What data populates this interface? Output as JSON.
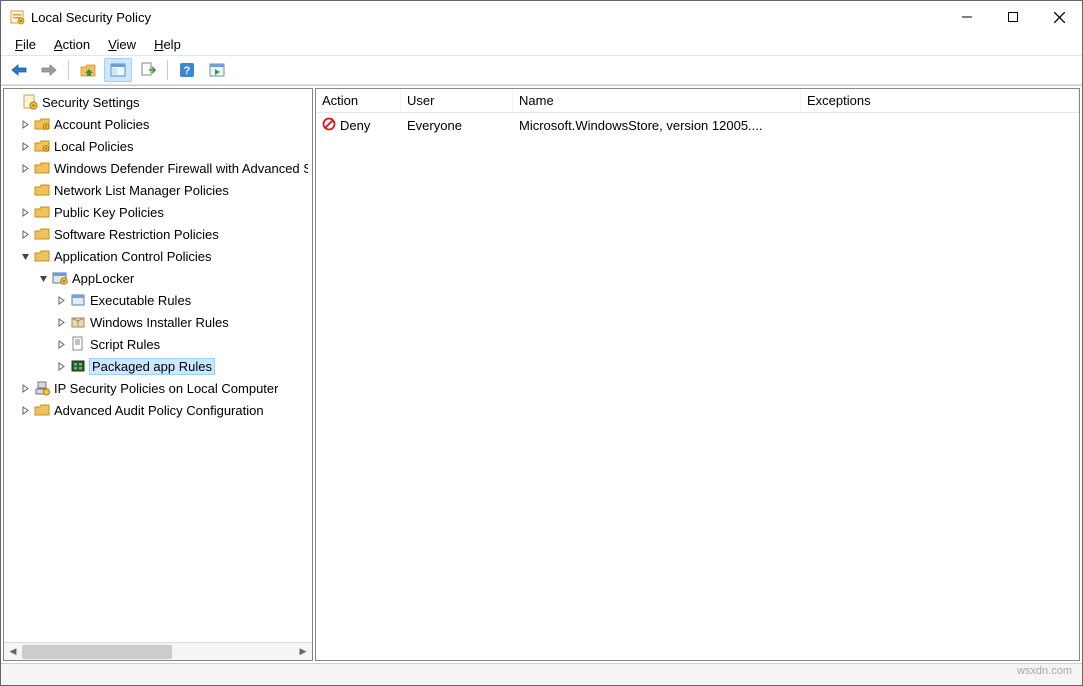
{
  "window": {
    "title": "Local Security Policy"
  },
  "menubar": {
    "file": "File",
    "action": "Action",
    "view": "View",
    "help": "Help"
  },
  "tree": {
    "root": "Security Settings",
    "account_policies": "Account Policies",
    "local_policies": "Local Policies",
    "wdf": "Windows Defender Firewall with Advanced Security",
    "nlm": "Network List Manager Policies",
    "pkp": "Public Key Policies",
    "srp": "Software Restriction Policies",
    "acp": "Application Control Policies",
    "applocker": "AppLocker",
    "exe_rules": "Executable Rules",
    "wi_rules": "Windows Installer Rules",
    "script_rules": "Script Rules",
    "pkg_rules": "Packaged app Rules",
    "ipsec": "IP Security Policies on Local Computer",
    "aapc": "Advanced Audit Policy Configuration"
  },
  "list": {
    "headers": {
      "action": "Action",
      "user": "User",
      "name": "Name",
      "exceptions": "Exceptions"
    },
    "rows": [
      {
        "action": "Deny",
        "user": "Everyone",
        "name": "Microsoft.WindowsStore, version 12005....",
        "exceptions": ""
      }
    ]
  },
  "watermark": "wsxdn.com"
}
